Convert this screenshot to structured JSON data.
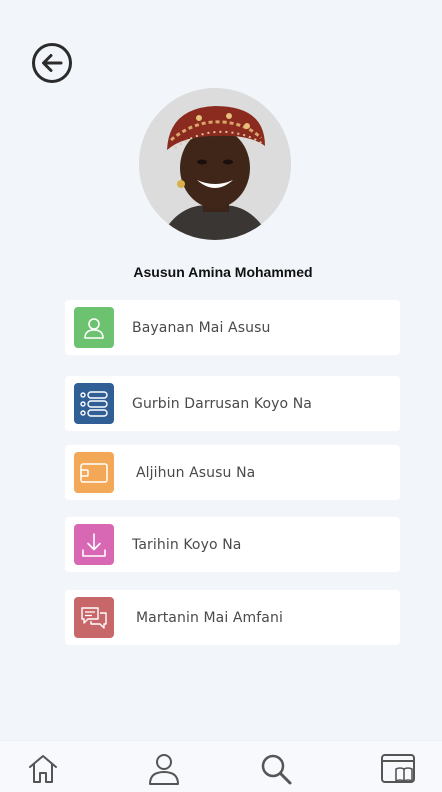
{
  "profile": {
    "name": "Asusun Amina Mohammed"
  },
  "menu": [
    {
      "label": "Bayanan Mai Asusu",
      "icon": "user-icon",
      "color": "#6cc26f"
    },
    {
      "label": "Gurbin Darrusan Koyo Na",
      "icon": "list-icon",
      "color": "#2f5f94"
    },
    {
      "label": "Aljihun Asusu Na",
      "icon": "wallet-icon",
      "color": "#f2a857"
    },
    {
      "label": "Tarihin Koyo Na",
      "icon": "download-icon",
      "color": "#d968b4"
    },
    {
      "label": "Martanin Mai Amfani",
      "icon": "chat-icon",
      "color": "#c8676a"
    }
  ],
  "nav": [
    {
      "icon": "home-icon"
    },
    {
      "icon": "profile-icon"
    },
    {
      "icon": "search-icon"
    },
    {
      "icon": "library-icon"
    }
  ]
}
